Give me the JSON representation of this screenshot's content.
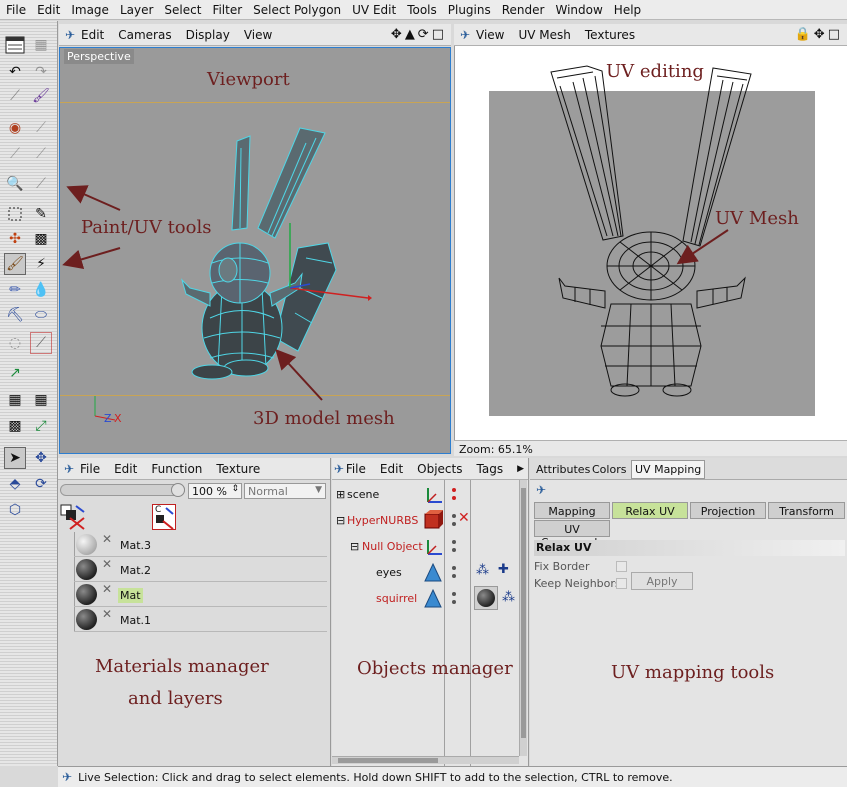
{
  "menubar": {
    "items": [
      "File",
      "Edit",
      "Image",
      "Layer",
      "Select",
      "Filter",
      "Select Polygon",
      "UV Edit",
      "Tools",
      "Plugins",
      "Render",
      "Window",
      "Help"
    ]
  },
  "viewport": {
    "menu": [
      "Edit",
      "Cameras",
      "Display",
      "View"
    ],
    "label": "Perspective",
    "axis_z": "Z",
    "axis_x": "X"
  },
  "uv": {
    "menu": [
      "View",
      "UV Mesh",
      "Textures"
    ],
    "zoom": "Zoom: 65.1%"
  },
  "materials": {
    "menu": [
      "File",
      "Edit",
      "Function",
      "Texture"
    ],
    "opacity": "100 %",
    "blend_mode": "Normal",
    "layer_letter": "C",
    "items": [
      {
        "name": "Mat.3",
        "light": true,
        "selected": false
      },
      {
        "name": "Mat.2",
        "light": false,
        "selected": false
      },
      {
        "name": "Mat",
        "light": false,
        "selected": true
      },
      {
        "name": "Mat.1",
        "light": false,
        "selected": false
      }
    ]
  },
  "objects": {
    "menu": [
      "File",
      "Edit",
      "Objects",
      "Tags"
    ],
    "items": [
      {
        "name": "scene",
        "indent": 0,
        "prefix": "⊞",
        "color": "#111111"
      },
      {
        "name": "HyperNURBS",
        "indent": 0,
        "prefix": "⊟",
        "color": "#c02020"
      },
      {
        "name": "Null Object",
        "indent": 1,
        "prefix": "⊟",
        "color": "#c02020"
      },
      {
        "name": "eyes",
        "indent": 2,
        "prefix": "",
        "color": "#111111"
      },
      {
        "name": "squirrel",
        "indent": 2,
        "prefix": "",
        "color": "#c02020"
      }
    ]
  },
  "attributes": {
    "top_tabs": [
      "Attributes",
      "Colors",
      "UV Mapping"
    ],
    "tabs": [
      "Mapping",
      "Relax UV",
      "Projection",
      "Transform"
    ],
    "sub_tab": "UV Commands",
    "section": "Relax UV",
    "options": [
      "Fix Border",
      "Keep Neighbors"
    ],
    "apply": "Apply"
  },
  "annotations": {
    "viewport": "Viewport",
    "uv_editing": "UV editing",
    "paint_tools": "Paint/UV tools",
    "uv_mesh": "UV Mesh",
    "model_mesh": "3D model mesh",
    "materials_1": "Materials manager",
    "materials_2": "and layers",
    "objects": "Objects manager",
    "uv_tools": "UV mapping tools"
  },
  "status": "Live Selection: Click and drag to select elements. Hold down SHIFT to add to the selection, CTRL to remove.",
  "colors": {
    "annotation": "#6d1f1f",
    "mesh_cyan": "#4fd6e6",
    "selected_green": "#c7e29a",
    "viewport_border": "#2d7ecf"
  }
}
